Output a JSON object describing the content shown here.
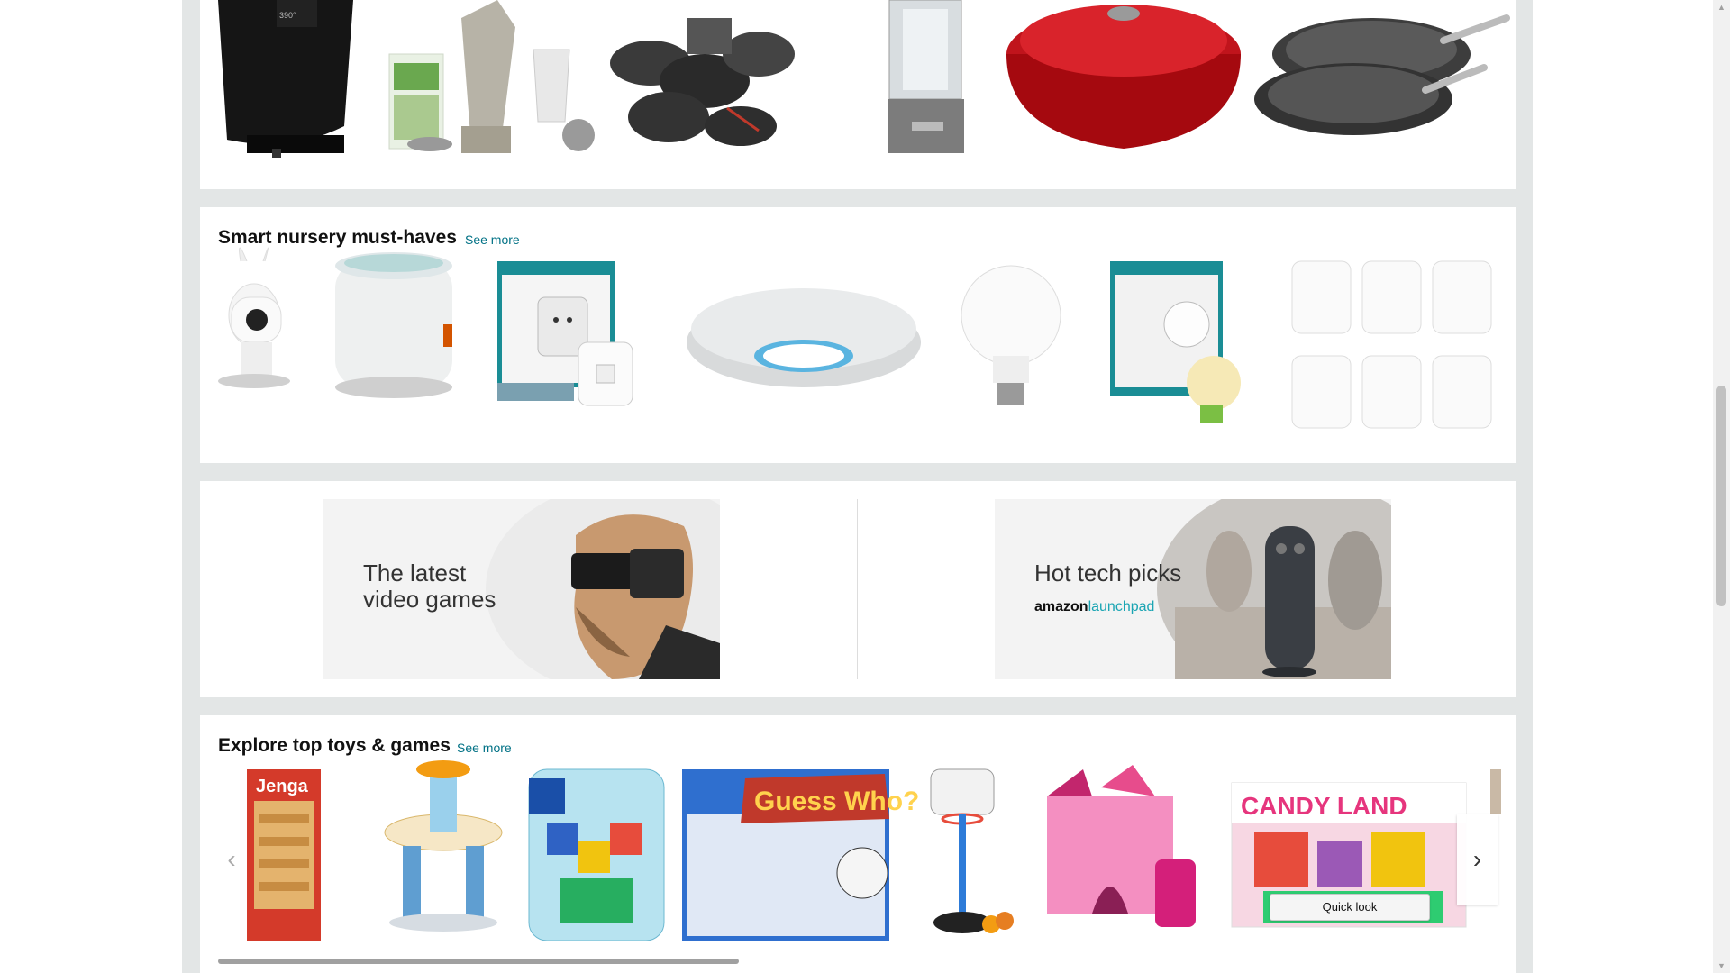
{
  "sections": {
    "kitchen": {
      "products": [
        "Air fryer",
        "Blender system",
        "Cookware set",
        "Food processor",
        "Dutch oven",
        "Fry pan set"
      ]
    },
    "nursery": {
      "title": "Smart nursery must-haves",
      "see_more": "See more",
      "products": [
        "Baby monitor camera",
        "Night light projector",
        "Smart Wi-Fi plug",
        "Smoke alarm",
        "Smart bulb",
        "Smart LED bulb",
        "Plug-in night lights"
      ]
    },
    "banners": {
      "left": {
        "line1": "The latest",
        "line2": "video games"
      },
      "right": {
        "line1": "Hot tech picks",
        "brand": "amazon",
        "brand_accent": "launchpad"
      }
    },
    "toys": {
      "title": "Explore top toys & games",
      "see_more": "See more",
      "quick_look": "Quick look",
      "products": [
        "Jenga",
        "Water table",
        "Mega Bloks",
        "Guess Who?",
        "Basketball set",
        "Castle tent",
        "Candy Land"
      ],
      "prev_icon": "chevron-left-icon",
      "next_icon": "chevron-right-icon"
    }
  },
  "colors": {
    "link": "#007185",
    "background": "#e3e6e6"
  }
}
